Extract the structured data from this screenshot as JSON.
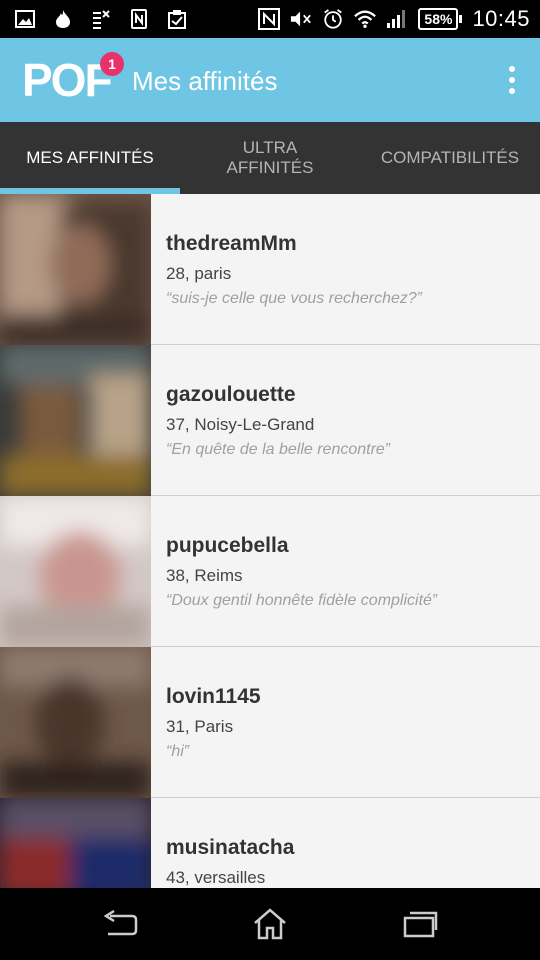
{
  "status_bar": {
    "battery": "58%",
    "time": "10:45",
    "icons": [
      "image-icon",
      "flame-icon",
      "sync-off-icon",
      "nfc-app-icon",
      "clipboard-check-icon",
      "nfc-icon",
      "mute-icon",
      "alarm-icon",
      "wifi-icon",
      "signal-icon"
    ]
  },
  "app_bar": {
    "logo": "POF",
    "badge": "1",
    "title": "Mes affinités",
    "overflow_icon": "overflow-menu-icon"
  },
  "tabs": [
    {
      "label": "MES AFFINITÉS",
      "active": true
    },
    {
      "label": "ULTRA AFFINITÉS",
      "active": false
    },
    {
      "label": "COMPATIBILITÉS",
      "active": false
    }
  ],
  "matches": [
    {
      "username": "thedreamMm",
      "meta": "28, paris",
      "quote": "“suis-je celle que vous recherchez?‟"
    },
    {
      "username": "gazoulouette",
      "meta": "37, Noisy-Le-Grand",
      "quote": "“En quête de la belle rencontre‟"
    },
    {
      "username": "pupucebella",
      "meta": "38, Reims",
      "quote": "“Doux gentil honnête fidèle complicité‟"
    },
    {
      "username": "lovin1145",
      "meta": "31, Paris",
      "quote": "“hi‟"
    },
    {
      "username": "musinatacha",
      "meta": "43, versailles",
      "quote": ""
    }
  ],
  "nav_bar": {
    "buttons": [
      "back-icon",
      "home-icon",
      "recents-icon"
    ]
  },
  "colors": {
    "accent": "#6ec6e4",
    "badge": "#e8336a",
    "tab_bar": "#333333",
    "list_bg": "#f4f4f4"
  }
}
